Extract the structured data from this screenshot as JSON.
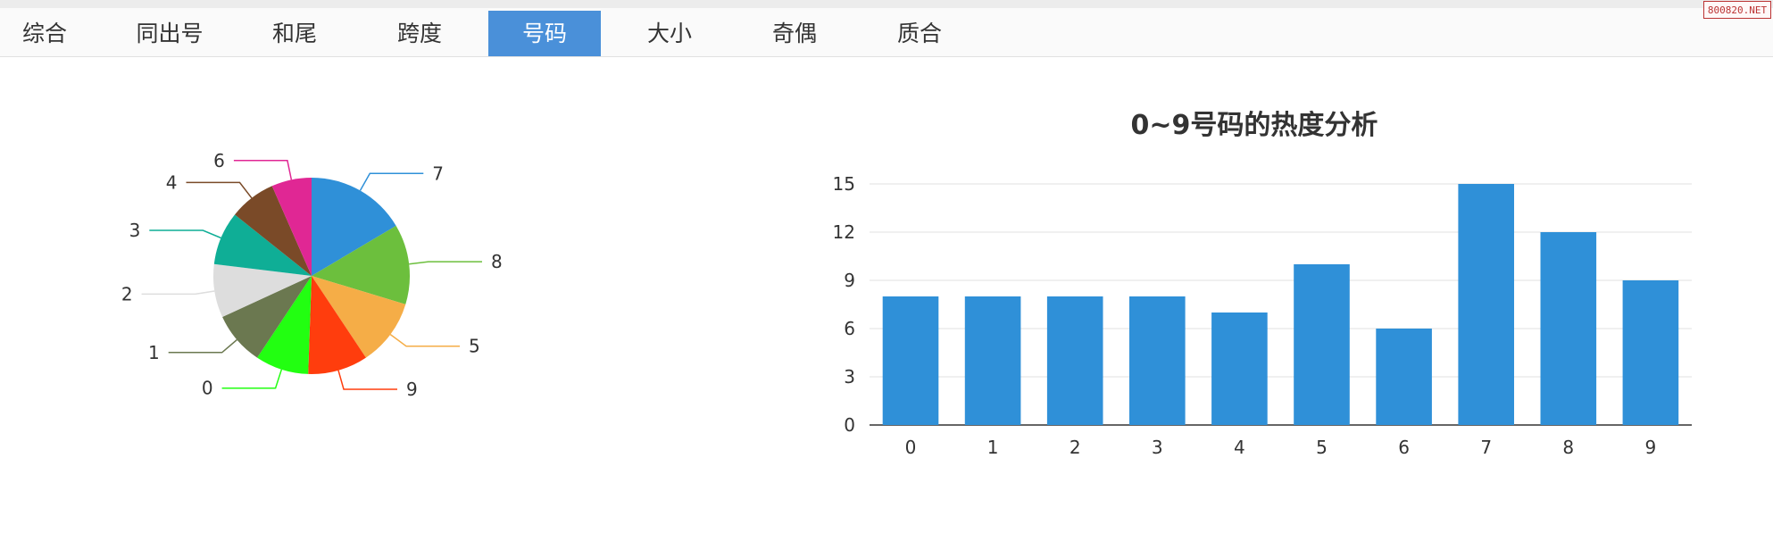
{
  "tabs": [
    {
      "label": "综合",
      "active": false
    },
    {
      "label": "同出号",
      "active": false
    },
    {
      "label": "和尾",
      "active": false
    },
    {
      "label": "跨度",
      "active": false
    },
    {
      "label": "号码",
      "active": true
    },
    {
      "label": "大小",
      "active": false
    },
    {
      "label": "奇偶",
      "active": false
    },
    {
      "label": "质合",
      "active": false
    }
  ],
  "watermark": "800820.NET",
  "colors": {
    "accent": "#4a90d9",
    "bar": "#2f90d8"
  },
  "chart_data": [
    {
      "type": "pie",
      "title": "",
      "slices": [
        {
          "label": "7",
          "value": 15,
          "color": "#2f90d8"
        },
        {
          "label": "8",
          "value": 12,
          "color": "#6cbf3d"
        },
        {
          "label": "5",
          "value": 10,
          "color": "#f5ad47"
        },
        {
          "label": "9",
          "value": 9,
          "color": "#ff3d0d"
        },
        {
          "label": "0",
          "value": 8,
          "color": "#22ff11"
        },
        {
          "label": "1",
          "value": 8,
          "color": "#6b7850"
        },
        {
          "label": "2",
          "value": 8,
          "color": "#dddddd"
        },
        {
          "label": "3",
          "value": 8,
          "color": "#0fae96"
        },
        {
          "label": "4",
          "value": 7,
          "color": "#7a4a28"
        },
        {
          "label": "6",
          "value": 6,
          "color": "#e02794"
        }
      ]
    },
    {
      "type": "bar",
      "title": "0~9号码的热度分析",
      "categories": [
        "0",
        "1",
        "2",
        "3",
        "4",
        "5",
        "6",
        "7",
        "8",
        "9"
      ],
      "values": [
        8,
        8,
        8,
        8,
        7,
        10,
        6,
        15,
        12,
        9
      ],
      "xlabel": "",
      "ylabel": "",
      "ylim": [
        0,
        15
      ],
      "yticks": [
        "0",
        "3",
        "6",
        "9",
        "12",
        "15"
      ],
      "grid": true
    }
  ]
}
